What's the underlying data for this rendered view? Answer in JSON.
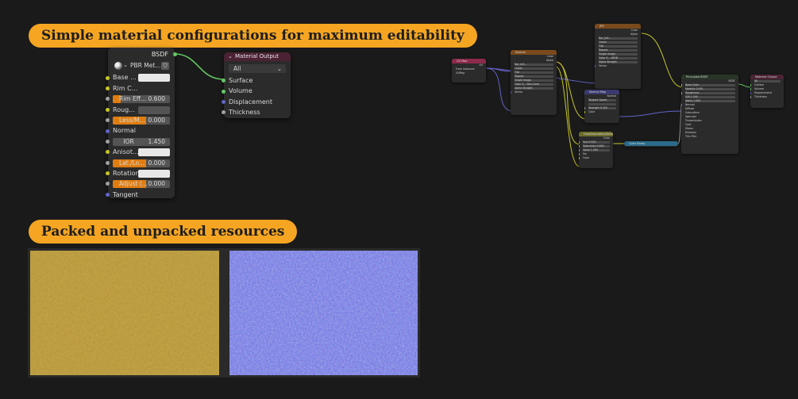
{
  "banners": {
    "top": "Simple material configurations for maximum editability",
    "bottom": "Packed and unpacked resources"
  },
  "bsdf_node": {
    "output": "BSDF",
    "shader": "PBR Met...",
    "rows": [
      {
        "label": "Base ...",
        "socket": "yellow",
        "field": "white"
      },
      {
        "label": "Rim C...",
        "socket": "yellow",
        "field": "none"
      },
      {
        "label": "Rim Eff...",
        "value": "0.600",
        "socket": "gray",
        "field": "orange",
        "fill": 0.55
      },
      {
        "label": "Roug...",
        "socket": "yellow",
        "field": "gray"
      },
      {
        "label": "Less/M...",
        "value": "0.000",
        "socket": "gray",
        "field": "orange",
        "fill": 1.0
      },
      {
        "label": "Normal",
        "socket": "purple",
        "field": "none"
      },
      {
        "label": "IOR",
        "value": "1.450",
        "socket": "gray",
        "field": "gray"
      },
      {
        "label": "Anisot...",
        "socket": "yellow",
        "field": "white"
      },
      {
        "label": "Lat./Lo...",
        "value": "0.000",
        "socket": "gray",
        "field": "orange",
        "fill": 1.0
      },
      {
        "label": "Rotation",
        "socket": "yellow",
        "field": "white"
      },
      {
        "label": "Adjust (...",
        "value": "0.000",
        "socket": "gray",
        "field": "orange",
        "fill": 1.0
      },
      {
        "label": "Tangent",
        "socket": "purple",
        "field": "none"
      }
    ]
  },
  "material_output": {
    "title": "Material Output",
    "target": "All",
    "inputs": [
      "Surface",
      "Volume",
      "Displacement",
      "Thickness"
    ]
  },
  "mini_graph": {
    "uv_map": {
      "title": "UV Map",
      "out": "UV",
      "rows": [
        "From Instancer",
        "UVMap"
      ]
    },
    "normal_tex": {
      "title": "Normal",
      "outs": [
        "Color",
        "Alpha"
      ],
      "rows": [
        "Nor_tx5...",
        "Linear",
        "Flat",
        "Repeat",
        "Single Image",
        "Color S...    Non-Color",
        "Alpha      Straight",
        "Vector"
      ]
    },
    "jpg_tex": {
      "title": "JPG",
      "outs": [
        "Color",
        "Alpha"
      ],
      "rows": [
        "Nor_tx5...",
        "Linear",
        "Flat",
        "Repeat",
        "Single Image",
        "Color S...    sRGB",
        "Alpha      Straight",
        "Vector"
      ]
    },
    "normal_map": {
      "title": "Normal Map",
      "out": "Normal",
      "rows": [
        "Tangent Space",
        "",
        "Strength    0.300",
        "Color"
      ]
    },
    "hsv": {
      "title": "Hue/Saturation/Value",
      "out": "Color",
      "rows": [
        "Hue      0.500",
        "Saturation    0.800",
        "Value     1.000",
        "Fac",
        "Color"
      ]
    },
    "color_ramp": {
      "title": "Color Ramp"
    },
    "principled": {
      "title": "Principled BSDF",
      "out": "BSDF",
      "rows": [
        "Base Color",
        "Metallic     0.000",
        "Roughness",
        "IOR        1.500",
        "Alpha       1.000",
        "Normal",
        "Diffuse",
        "Subsurface",
        "Specular",
        "Transmission",
        "Coat",
        "Sheen",
        "Emission",
        "Thin Film"
      ]
    },
    "mat_out": {
      "title": "Material Output",
      "rows": [
        "All",
        "Surface",
        "Volume",
        "Displacement",
        "Thickness"
      ]
    }
  },
  "colors": {
    "banner": "#f5a522",
    "background": "#1a1a1a",
    "node": "#2b2b2b",
    "shader_header": "#283628",
    "output_header": "#4b2234",
    "texture_header": "#7a4a1c",
    "uv_header": "#8c2a4a",
    "vector_header": "#3a3a6e",
    "color_header": "#6b6b2a",
    "converter_header": "#2a6a8a",
    "albedo_tint": "#c4a445",
    "normal_tint": "#7a7ae8"
  }
}
